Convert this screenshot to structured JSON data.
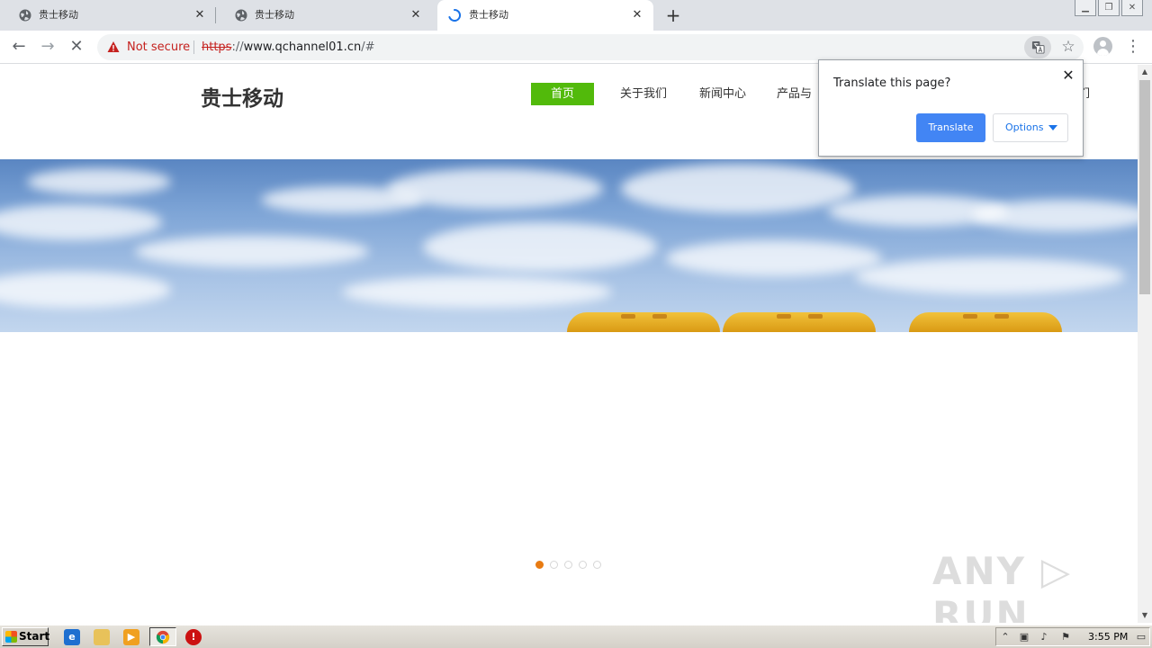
{
  "browser": {
    "tabs": [
      {
        "title": "贵士移动",
        "state": "inactive"
      },
      {
        "title": "贵士移动",
        "state": "inactive"
      },
      {
        "title": "贵士移动",
        "state": "loading-active"
      }
    ],
    "new_tab_glyph": "+",
    "close_glyph": "✕",
    "address": {
      "security_label": "Not secure",
      "url_scheme": "https",
      "url_rest_prefix": "://",
      "url_host": "www.qchannel01.cn",
      "url_path": "/#"
    }
  },
  "translate_popup": {
    "title": "Translate this page?",
    "translate_label": "Translate",
    "options_label": "Options"
  },
  "site": {
    "logo": "贵士移动",
    "nav": [
      {
        "label": "首页",
        "current": true
      },
      {
        "label": "关于我们",
        "current": false
      },
      {
        "label": "新闻中心",
        "current": false
      },
      {
        "label": "产品与",
        "current": false
      }
    ],
    "nav_tail_visible": "我们",
    "carousel": {
      "total": 5,
      "active_index": 0
    }
  },
  "watermark": "ANY ▷ RUN",
  "taskbar": {
    "start_label": "Start",
    "clock": "3:55 PM"
  },
  "colors": {
    "nav_active": "#52ba0b",
    "carousel_dot_active": "#e87b12",
    "translate_button": "#4285f4",
    "not_secure": "#c5221f"
  },
  "icons": {
    "tab_favicon": "globe-icon",
    "loading": "spinner-icon",
    "warning": "warning-triangle-icon",
    "translate": "translate-icon",
    "bookmark": "star-icon",
    "profile": "account-icon",
    "menu": "kebab-menu-icon"
  }
}
